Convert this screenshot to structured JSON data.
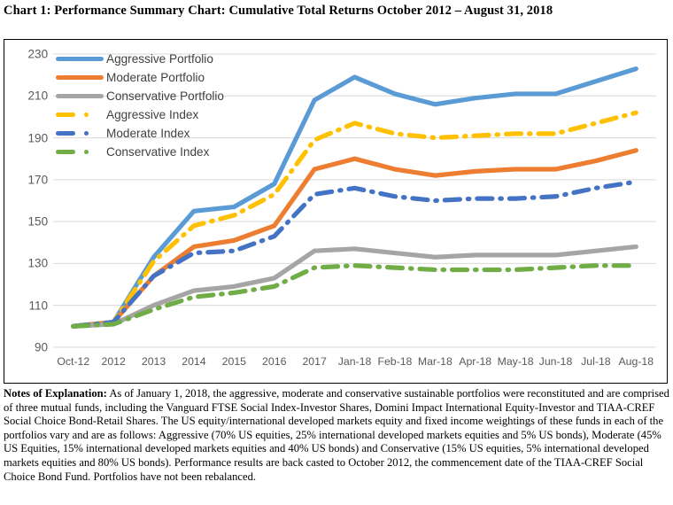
{
  "title": "Chart 1:  Performance Summary Chart:  Cumulative Total Returns October 2012 – August 31, 2018",
  "notes": {
    "heading": "Notes of Explanation:",
    "body": "  As of January 1, 2018, the aggressive, moderate and conservative sustainable portfolios were reconstituted and are comprised of three mutual funds, including the Vanguard FTSE Social Index-Investor Shares, Domini Impact International Equity-Investor and TIAA-CREF Social Choice Bond-Retail Shares. The US equity/international developed markets equity and fixed income weightings of these funds in each of the portfolios vary and are as follows:  Aggressive (70% US equities, 25% international developed markets equities and 5% US bonds), Moderate (45% US Equities, 15% international developed markets equities and 40% US bonds) and Conservative (15% US equities, 5% international developed markets equities and 80% US bonds).  Performance results are back casted to October 2012, the commencement date of the TIAA-CREF Social Choice Bond Fund.  Portfolios have not been rebalanced."
  },
  "chart_data": {
    "type": "line",
    "title": "Cumulative Total Returns October 2012 – August 31, 2018",
    "xlabel": "",
    "ylabel": "",
    "categories": [
      "Oct-12",
      "2012",
      "2013",
      "2014",
      "2015",
      "2016",
      "2017",
      "Jan-18",
      "Feb-18",
      "Mar-18",
      "Apr-18",
      "May-18",
      "Jun-18",
      "Jul-18",
      "Aug-18"
    ],
    "ylim": [
      90,
      230
    ],
    "yticks": [
      90,
      110,
      130,
      150,
      170,
      190,
      210,
      230
    ],
    "grid": true,
    "legend_position": "top-left",
    "series": [
      {
        "name": "Aggressive Portfolio",
        "color": "#5B9BD5",
        "style": "solid",
        "values": [
          100,
          102,
          133,
          155,
          157,
          168,
          208,
          219,
          211,
          206,
          209,
          211,
          211,
          217,
          223
        ]
      },
      {
        "name": "Moderate Portfolio",
        "color": "#ED7D31",
        "style": "solid",
        "values": [
          100,
          102,
          124,
          138,
          141,
          148,
          175,
          180,
          175,
          172,
          174,
          175,
          175,
          179,
          184
        ]
      },
      {
        "name": "Conservative Portfolio",
        "color": "#A5A5A5",
        "style": "solid",
        "values": [
          100,
          101,
          110,
          117,
          119,
          123,
          136,
          137,
          135,
          133,
          134,
          134,
          134,
          136,
          138
        ]
      },
      {
        "name": "Aggressive Index",
        "color": "#FFC000",
        "style": "dashed",
        "values": [
          100,
          102,
          131,
          148,
          153,
          163,
          189,
          197,
          192,
          190,
          191,
          192,
          192,
          197,
          202
        ]
      },
      {
        "name": "Moderate Index",
        "color": "#4472C4",
        "style": "dashed",
        "values": [
          100,
          102,
          124,
          135,
          136,
          143,
          163,
          166,
          162,
          160,
          161,
          161,
          162,
          166,
          169
        ]
      },
      {
        "name": "Conservative Index",
        "color": "#70AD47",
        "style": "dashed",
        "values": [
          100,
          101,
          108,
          114,
          116,
          119,
          128,
          129,
          128,
          127,
          127,
          127,
          128,
          129,
          129
        ]
      }
    ]
  }
}
